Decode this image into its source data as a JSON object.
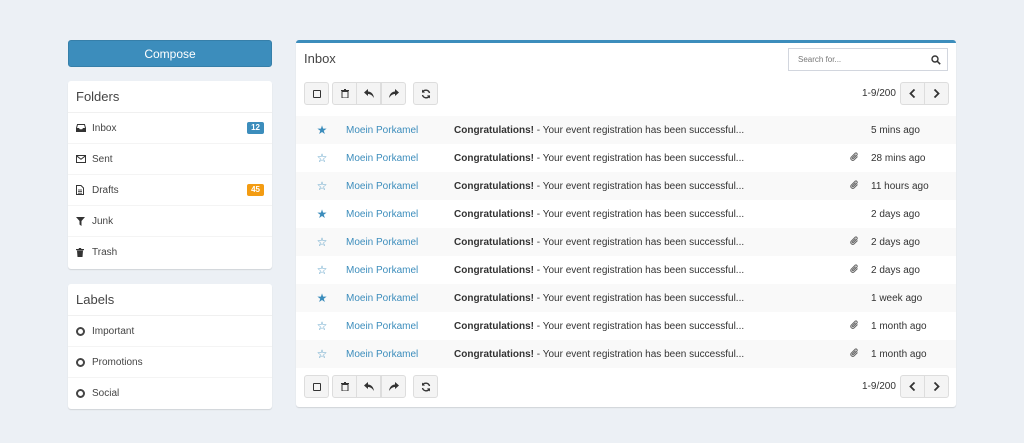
{
  "compose_label": "Compose",
  "folders": {
    "title": "Folders",
    "items": [
      {
        "label": "Inbox",
        "icon": "inbox-icon",
        "badge": "12",
        "badge_color": "#3c8dbc"
      },
      {
        "label": "Sent",
        "icon": "envelope-icon",
        "badge": "",
        "badge_color": ""
      },
      {
        "label": "Drafts",
        "icon": "file-icon",
        "badge": "45",
        "badge_color": "#f39c12"
      },
      {
        "label": "Junk",
        "icon": "filter-icon",
        "badge": "",
        "badge_color": ""
      },
      {
        "label": "Trash",
        "icon": "trash-icon",
        "badge": "",
        "badge_color": ""
      }
    ]
  },
  "labels": {
    "title": "Labels",
    "items": [
      {
        "label": "Important",
        "icon": "circle-icon"
      },
      {
        "label": "Promotions",
        "icon": "circle-icon"
      },
      {
        "label": "Social",
        "icon": "circle-icon"
      }
    ]
  },
  "inbox": {
    "title": "Inbox",
    "search_placeholder": "Search for...",
    "page_info_top": "1-9/200",
    "page_info_bottom": "1-9/200"
  },
  "messages": [
    {
      "starred": true,
      "sender": "Moein Porkamel",
      "subject": "Congratulations!",
      "preview": " - Your event registration has been successful...",
      "attachment": false,
      "time": "5 mins ago"
    },
    {
      "starred": false,
      "sender": "Moein Porkamel",
      "subject": "Congratulations!",
      "preview": " - Your event registration has been successful...",
      "attachment": true,
      "time": "28 mins ago"
    },
    {
      "starred": false,
      "sender": "Moein Porkamel",
      "subject": "Congratulations!",
      "preview": " - Your event registration has been successful...",
      "attachment": true,
      "time": "11 hours ago"
    },
    {
      "starred": true,
      "sender": "Moein Porkamel",
      "subject": "Congratulations!",
      "preview": " - Your event registration has been successful...",
      "attachment": false,
      "time": "2 days ago"
    },
    {
      "starred": false,
      "sender": "Moein Porkamel",
      "subject": "Congratulations!",
      "preview": " - Your event registration has been successful...",
      "attachment": true,
      "time": "2 days ago"
    },
    {
      "starred": false,
      "sender": "Moein Porkamel",
      "subject": "Congratulations!",
      "preview": " - Your event registration has been successful...",
      "attachment": true,
      "time": "2 days ago"
    },
    {
      "starred": true,
      "sender": "Moein Porkamel",
      "subject": "Congratulations!",
      "preview": " - Your event registration has been successful...",
      "attachment": false,
      "time": "1 week ago"
    },
    {
      "starred": false,
      "sender": "Moein Porkamel",
      "subject": "Congratulations!",
      "preview": " - Your event registration has been successful...",
      "attachment": true,
      "time": "1 month ago"
    },
    {
      "starred": false,
      "sender": "Moein Porkamel",
      "subject": "Congratulations!",
      "preview": " - Your event registration has been successful...",
      "attachment": true,
      "time": "1 month ago"
    }
  ]
}
